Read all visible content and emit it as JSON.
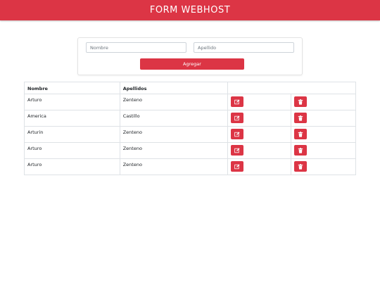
{
  "navbar": {
    "title": "FORM WEBHOST"
  },
  "form": {
    "nombre_placeholder": "Nombre",
    "apellido_placeholder": "Apellido",
    "nombre_value": "",
    "apellido_value": "",
    "submit_label": "Agregar"
  },
  "table": {
    "headers": {
      "nombre": "Nombre",
      "apellidos": "Apellidos",
      "actions": ""
    },
    "rows": [
      {
        "nombre": "Arturo",
        "apellidos": "Zenteno"
      },
      {
        "nombre": "America",
        "apellidos": "Castillo"
      },
      {
        "nombre": "Arturin",
        "apellidos": "Zenteno"
      },
      {
        "nombre": "Arturo",
        "apellidos": "Zenteno"
      },
      {
        "nombre": "Arturo",
        "apellidos": "Zenteno"
      }
    ],
    "edit_icon": "edit-icon",
    "delete_icon": "trash-icon"
  },
  "colors": {
    "accent": "#dc3545",
    "border": "#dee2e6"
  }
}
